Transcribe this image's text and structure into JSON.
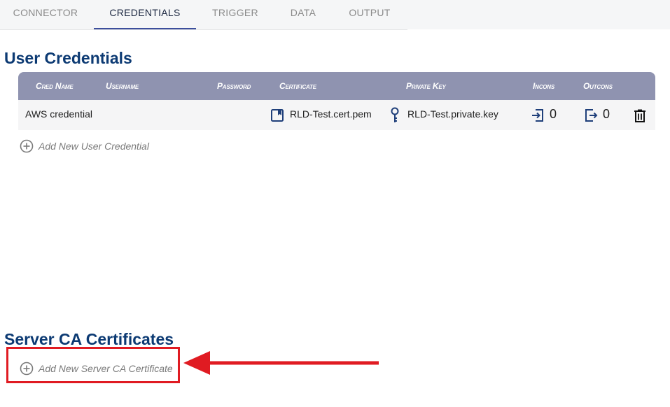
{
  "tabs": [
    {
      "label": "CONNECTOR"
    },
    {
      "label": "CREDENTIALS"
    },
    {
      "label": "TRIGGER"
    },
    {
      "label": "DATA"
    },
    {
      "label": "OUTPUT"
    }
  ],
  "user_credentials": {
    "title": "User Credentials",
    "columns": [
      "Cred Name",
      "Username",
      "Password",
      "Certificate",
      "Private Key",
      "Incons",
      "Outcons"
    ],
    "rows": [
      {
        "cred_name": "AWS credential",
        "username": "",
        "password": "",
        "certificate": "RLD-Test.cert.pem",
        "private_key": "RLD-Test.private.key",
        "incons": "0",
        "outcons": "0"
      }
    ],
    "add_label": "Add New User Credential"
  },
  "server_ca": {
    "title": "Server CA Certificates",
    "add_label": "Add New Server CA Certificate"
  },
  "colors": {
    "accent": "#3c4f9c",
    "title": "#0c3a73",
    "header": "#8f93b0",
    "annotation": "#e01b22"
  }
}
